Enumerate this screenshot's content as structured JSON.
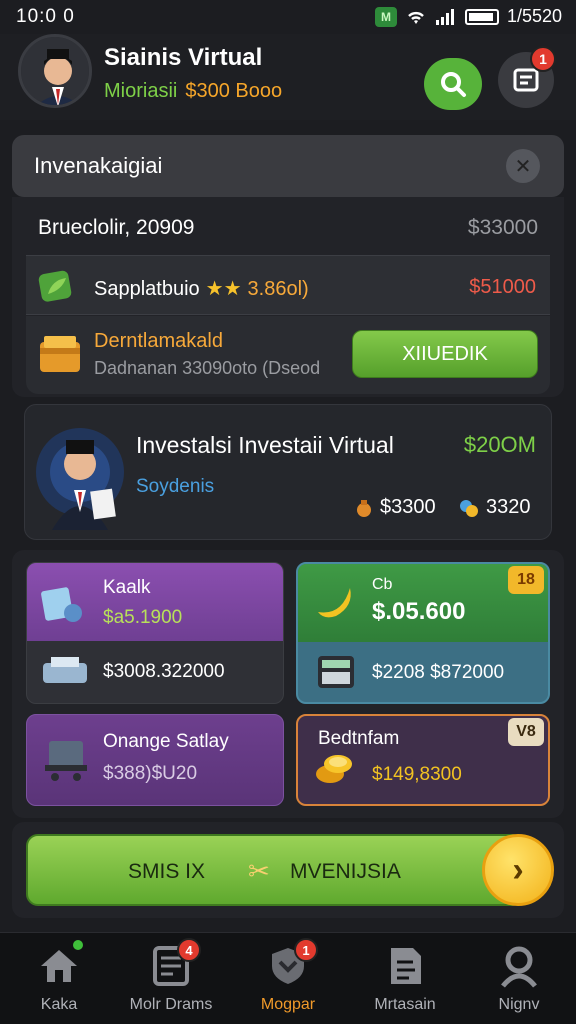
{
  "status_bar": {
    "time": "10:0 0",
    "right_text": "1/5520",
    "app_icon": "M"
  },
  "header": {
    "name": "Siainis Virtual",
    "sub_label": "Mioriasii",
    "sub_balance": "$300 Booo",
    "notif_count": "1"
  },
  "search": {
    "title": "Invenakaigiai"
  },
  "balance": {
    "date": "Brueclolir, 20909",
    "amount": "$33000",
    "row1": {
      "name": "Sapplatbuio",
      "stars": "★★",
      "extra": "3.86ol)",
      "value": "$51000"
    },
    "row2": {
      "title": "Derntlamakald",
      "sub": "Dadnanan 33090oto (Dseod",
      "button": "XIIUEDIK"
    }
  },
  "investor": {
    "title": "Investalsi Investaii Virtual",
    "value": "$20OM",
    "sub": "Soydenis",
    "stat1": "$3300",
    "stat2": "3320"
  },
  "tiles": [
    {
      "label": "Kaalk",
      "value": "$a5.1900",
      "bottom": "$3008.322000"
    },
    {
      "label": "Cb",
      "value": "$.05.600",
      "bottom": "$2208 $872000",
      "tag": "18"
    },
    {
      "label": "Onange Satlay",
      "value": "$388)$U20"
    },
    {
      "label": "Bedtnfam",
      "value": "$149,8300",
      "tag": "V8"
    }
  ],
  "action": {
    "left": "SMIS IX",
    "right": "MVENIJSIA"
  },
  "nav": [
    {
      "label": "Kaka",
      "badge": ""
    },
    {
      "label": "Molr Drams",
      "badge": "4"
    },
    {
      "label": "Mogpar",
      "badge": "1",
      "active": true
    },
    {
      "label": "Mrtasain",
      "badge": ""
    },
    {
      "label": "Nignv",
      "badge": ""
    }
  ],
  "colors": {
    "accent_green": "#57b33a",
    "accent_orange": "#f19a2a",
    "badge_red": "#e23a2e"
  }
}
